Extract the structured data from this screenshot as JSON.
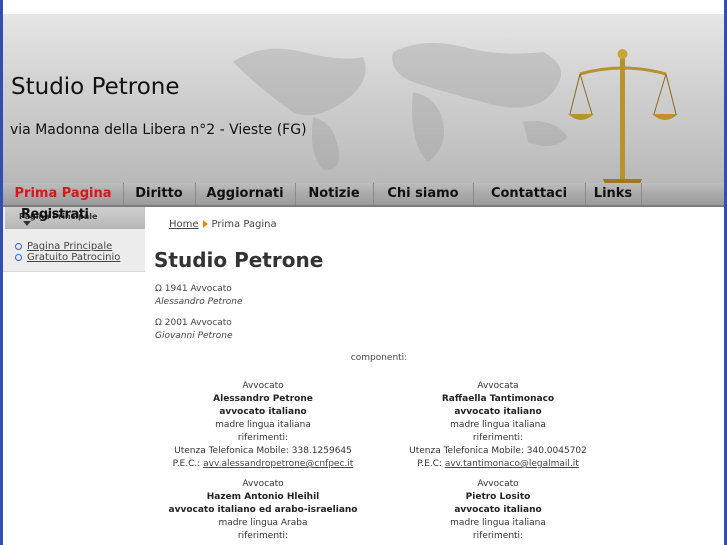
{
  "site": {
    "title": "Studio Petrone",
    "subtitle": "via Madonna della Libera n°2 - Vieste (FG)"
  },
  "nav": {
    "items": [
      {
        "label": "Prima Pagina",
        "active": true
      },
      {
        "label": "Diritto",
        "active": false
      },
      {
        "label": "Aggiornati",
        "active": false
      },
      {
        "label": "Notizie",
        "active": false
      },
      {
        "label": "Chi siamo",
        "active": false
      },
      {
        "label": "Contattaci",
        "active": false
      },
      {
        "label": "Links",
        "active": false
      }
    ]
  },
  "sidebar": {
    "heading": "Registrati",
    "heading_overlap": "Pagina Principale",
    "links": [
      {
        "label": "Pagina Principale"
      },
      {
        "label": "Gratuito Patrocinio"
      }
    ]
  },
  "breadcrumb": {
    "home": "Home",
    "current": "Prima Pagina"
  },
  "main": {
    "title": "Studio Petrone",
    "founders": [
      {
        "line": "Ω 1941 Avvocato",
        "name": "Alessandro Petrone"
      },
      {
        "line": "Ω 2001 Avvocato",
        "name": "Giovanni Petrone"
      }
    ],
    "components_label": "componenti:",
    "members": [
      {
        "role": "Avvocato",
        "name": "Alessandro Petrone",
        "title": "avvocato italiano",
        "language": "madre lingua italiana",
        "ref": "riferimenti:",
        "phone": "Utenza Telefonica Mobile: 338.1259645",
        "pec_label": "P.E.C.:",
        "pec": "avv.alessandropetrone@cnfpec.it"
      },
      {
        "role": "Avvocata",
        "name": "Raffaella Tantimonaco",
        "title": "avvocato italiano",
        "language": "madre lingua italiana",
        "ref": "riferimenti:",
        "phone": "Utenza Telefonica Mobile: 340.0045702",
        "pec_label": "P.E.C:",
        "pec": "avv.tantimonaco@legalmail.it"
      },
      {
        "role": "Avvocato",
        "name": "Hazem Antonio Hleihil",
        "title": "avvocato italiano ed arabo-israeliano",
        "language": "madre lingua Araba",
        "ref": "riferimenti:"
      },
      {
        "role": "Avvocato",
        "name": "Pietro Losito",
        "title": "avvocato italiano",
        "language": "madre lingua italiana",
        "ref": "riferimenti:"
      }
    ]
  },
  "colors": {
    "nav_active": "#d11919",
    "frame": "#2f50b0",
    "bullet": "#3a5fc4"
  }
}
